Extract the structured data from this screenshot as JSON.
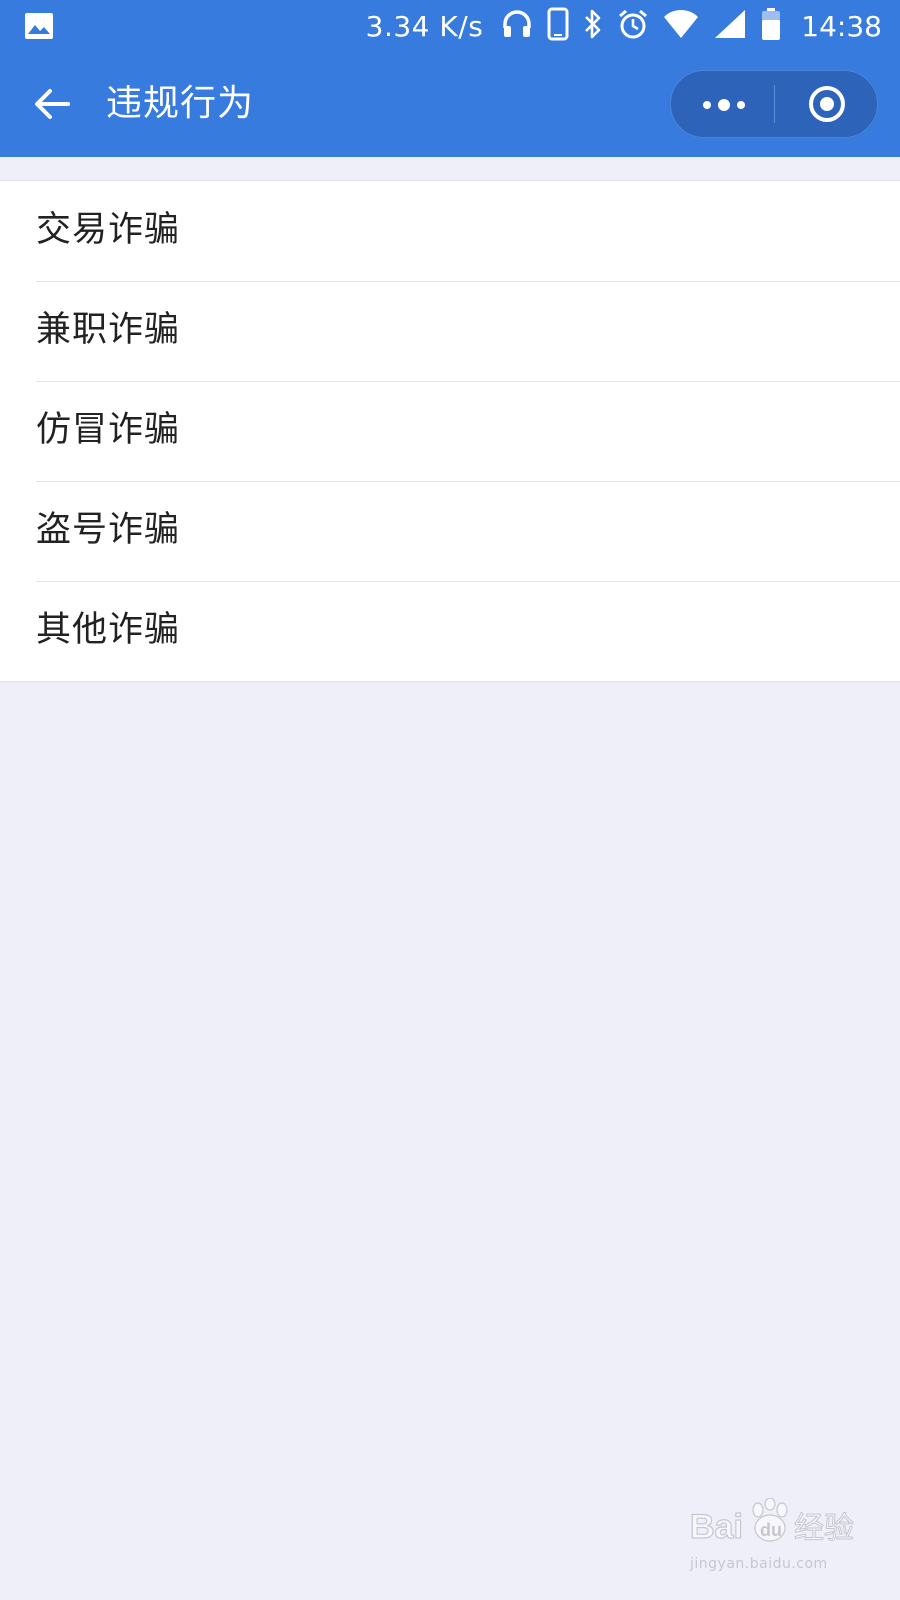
{
  "status_bar": {
    "network_speed": "3.34 K/s",
    "time": "14:38",
    "icons": [
      "image-notification-icon",
      "headset-icon",
      "phone-icon",
      "bluetooth-icon",
      "alarm-icon",
      "wifi-icon",
      "signal-icon",
      "battery-icon"
    ]
  },
  "nav": {
    "title": "违规行为",
    "back_icon": "back-arrow-icon",
    "more_icon": "more-dots-icon",
    "close_icon": "target-circle-icon"
  },
  "list": {
    "items": [
      {
        "label": "交易诈骗"
      },
      {
        "label": "兼职诈骗"
      },
      {
        "label": "仿冒诈骗"
      },
      {
        "label": "盗号诈骗"
      },
      {
        "label": "其他诈骗"
      }
    ]
  },
  "watermark": {
    "logo_text": "Bai du 经验",
    "url": "jingyan.baidu.com"
  },
  "colors": {
    "header": "#377bdf",
    "capsule": "#2d63b8",
    "background": "#eeeff8",
    "list_bg": "#ffffff",
    "text": "#222222"
  }
}
